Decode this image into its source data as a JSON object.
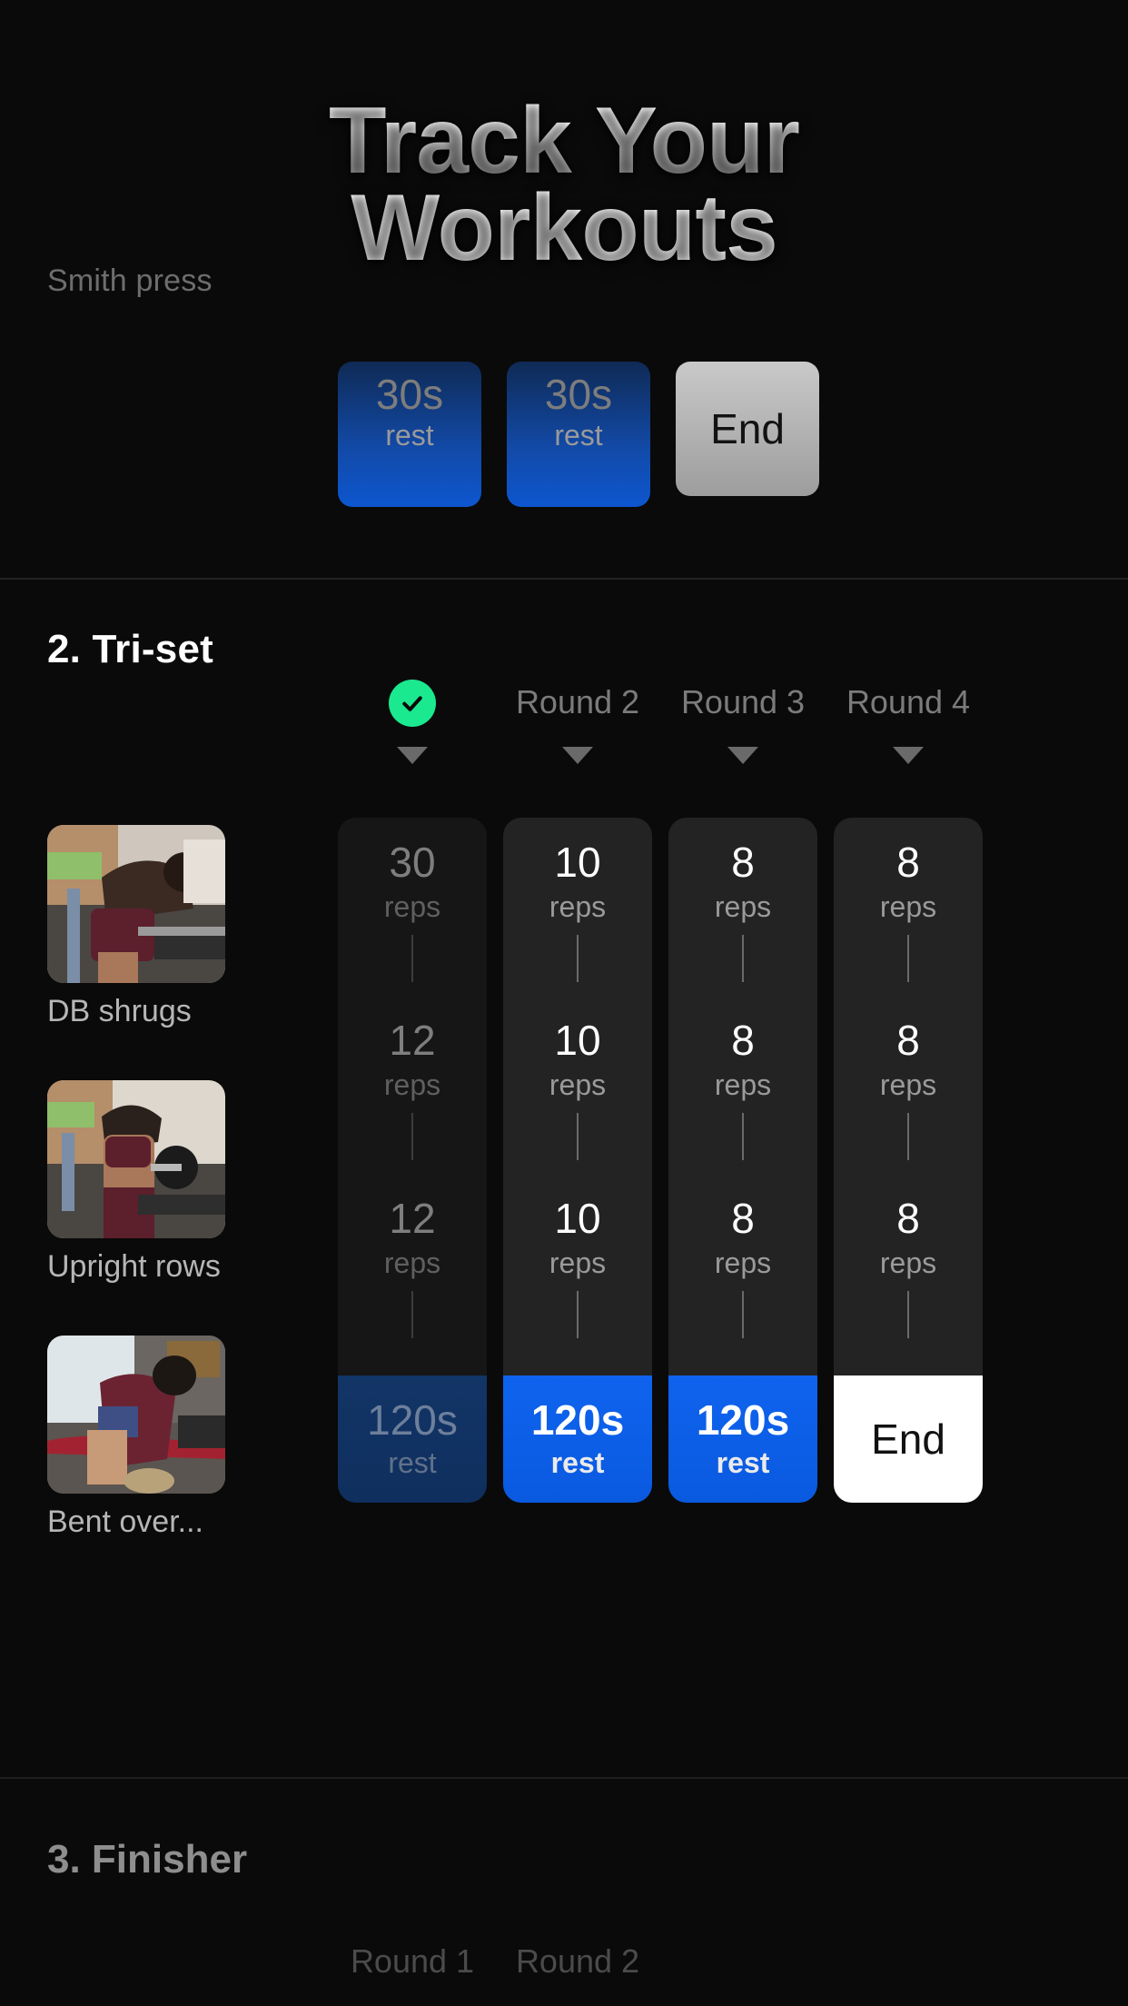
{
  "hero": {
    "title_line1": "Track Your",
    "title_line2": "Workouts"
  },
  "top_section": {
    "exercise_label": "Smith press",
    "bars": [
      {
        "value": "30s",
        "unit": "rest",
        "kind": "rest-dim"
      },
      {
        "value": "30s",
        "unit": "rest",
        "kind": "rest-dim"
      },
      {
        "value": "End",
        "unit": "",
        "kind": "end"
      }
    ]
  },
  "triset": {
    "section_title": "2. Tri-set",
    "round_headers": [
      {
        "label": "",
        "completed": true
      },
      {
        "label": "Round 2",
        "completed": false
      },
      {
        "label": "Round 3",
        "completed": false
      },
      {
        "label": "Round 4",
        "completed": false
      }
    ],
    "exercises": [
      {
        "name": "DB shrugs"
      },
      {
        "name": "Upright rows"
      },
      {
        "name": "Bent over..."
      }
    ],
    "unit_label": "reps",
    "rest_label": "rest",
    "end_label": "End",
    "columns": [
      {
        "state": "dim",
        "reps": [
          "30",
          "12",
          "12"
        ],
        "rest": "120s",
        "footer_kind": "rest"
      },
      {
        "state": "active",
        "reps": [
          "10",
          "10",
          "10"
        ],
        "rest": "120s",
        "footer_kind": "rest"
      },
      {
        "state": "active",
        "reps": [
          "8",
          "8",
          "8"
        ],
        "rest": "120s",
        "footer_kind": "rest"
      },
      {
        "state": "active",
        "reps": [
          "8",
          "8",
          "8"
        ],
        "rest": "End",
        "footer_kind": "end"
      }
    ]
  },
  "finisher": {
    "section_title": "3. Finisher",
    "round_headers": [
      "Round 1",
      "Round 2"
    ]
  },
  "colors": {
    "background": "#0a0a0a",
    "accent_blue": "#0f63ee",
    "accent_blue_dim": "#123567",
    "success_green": "#1ae98f",
    "panel": "#232323",
    "panel_dim": "#161616",
    "text_primary": "#ffffff",
    "text_muted": "#9a9a9a"
  }
}
